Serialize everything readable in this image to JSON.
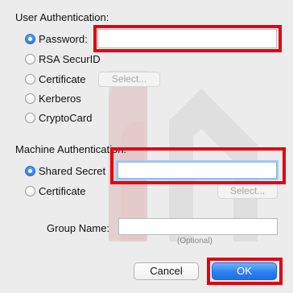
{
  "user_auth": {
    "title": "User Authentication:",
    "options": [
      {
        "label": "Password:",
        "selected": true
      },
      {
        "label": "RSA SecurID",
        "selected": false
      },
      {
        "label": "Certificate",
        "selected": false
      },
      {
        "label": "Kerberos",
        "selected": false
      },
      {
        "label": "CryptoCard",
        "selected": false
      }
    ],
    "password_value": "",
    "select_label": "Select..."
  },
  "machine_auth": {
    "title": "Machine Authentication:",
    "options": [
      {
        "label": "Shared Secret",
        "selected": true
      },
      {
        "label": "Certificate",
        "selected": false
      }
    ],
    "shared_secret_value": "",
    "select_label": "Select..."
  },
  "group": {
    "label": "Group Name:",
    "value": "",
    "hint": "(Optional)"
  },
  "buttons": {
    "cancel": "Cancel",
    "ok": "OK"
  },
  "colors": {
    "background": "#ececec",
    "highlight": "#e4000f",
    "accent": "#2a7df0"
  }
}
